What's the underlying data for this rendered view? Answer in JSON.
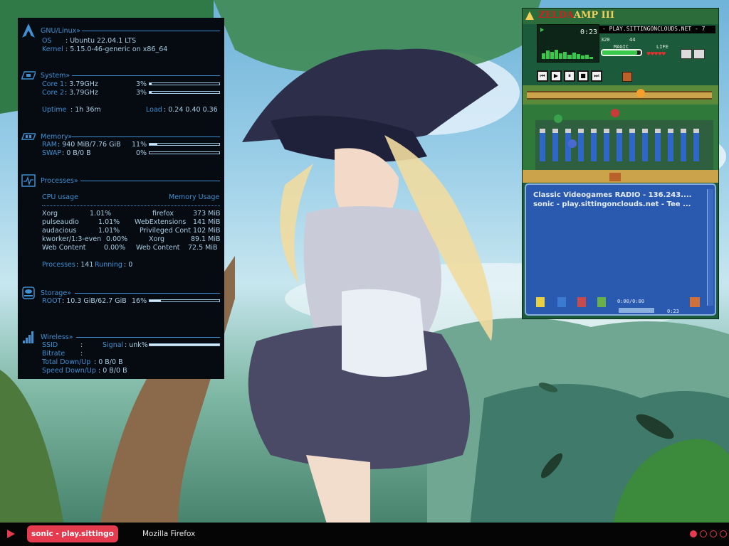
{
  "conky": {
    "gnu": {
      "title": "GNU/Linux»",
      "os_label": "OS",
      "os_value": ": Ubuntu 22.04.1 LTS",
      "kernel_label": "Kernel",
      "kernel_value": ": 5.15.0-46-generic on x86_64"
    },
    "system": {
      "title": "System»",
      "cores": [
        {
          "label": "Core 1",
          "value": ": 3.79GHz",
          "pct": "3%",
          "fill": 0.03
        },
        {
          "label": "Core 2",
          "value": ": 3.79GHz",
          "pct": "3%",
          "fill": 0.03
        }
      ],
      "uptime_label": "Uptime",
      "uptime_value": ": 1h 36m",
      "load_label": "Load",
      "load_value": ": 0.24 0.40 0.36"
    },
    "memory": {
      "title": "Memory»",
      "ram_label": "RAM",
      "ram_value": ": 940 MiB/7.76 GiB",
      "ram_pct": "11%",
      "ram_fill": 0.11,
      "swap_label": "SWAP",
      "swap_value": ": 0 B/0 B",
      "swap_pct": "0%",
      "swap_fill": 0
    },
    "processes": {
      "title": "Processes»",
      "cpu_header": "CPU usage",
      "mem_header": "Memory Usage",
      "cpu_rows": [
        {
          "name": "Xorg",
          "value": "1.01%"
        },
        {
          "name": "pulseaudio",
          "value": "1.01%"
        },
        {
          "name": "audacious",
          "value": "1.01%"
        },
        {
          "name": "kworker/1:3-even",
          "value": "0.00%"
        },
        {
          "name": "Web Content",
          "value": "0.00%"
        }
      ],
      "mem_rows": [
        {
          "name": "firefox",
          "value": "373 MiB"
        },
        {
          "name": "WebExtensions",
          "value": "141 MiB"
        },
        {
          "name": "Privileged Cont",
          "value": "102 MiB"
        },
        {
          "name": "Xorg",
          "value": "89.1 MiB"
        },
        {
          "name": "Web Content",
          "value": "72.5 MiB"
        }
      ],
      "count_label": "Processes",
      "count_value": ": 141",
      "running_label": "Running",
      "running_value": ": 0"
    },
    "storage": {
      "title": "Storage»",
      "root_label": "ROOT",
      "root_value": ": 10.3 GiB/62.7 GiB",
      "root_pct": "16%",
      "root_fill": 0.16
    },
    "wireless": {
      "title": "Wireless»",
      "ssid_label": "SSID",
      "ssid_value": ":",
      "signal_label": "Signal",
      "signal_value": ": unk%",
      "signal_fill": 1.0,
      "bitrate_label": "Bitrate",
      "bitrate_value": ":",
      "total_label": "Total Down/Up",
      "total_value": ": 0 B/0 B",
      "speed_label": "Speed Down/Up",
      "speed_value": ": 0 B/0 B"
    }
  },
  "amp": {
    "logo_main": "ZELDA",
    "logo_sub": "AMP III",
    "time": "0:23",
    "marquee": "- PLAY.SITTINGONCLOUDS.NET - 7",
    "bitrate": "320",
    "samplerate": "44",
    "magic_label": "MAGIC",
    "life_label": "LIFE",
    "magic_fill": 0.9,
    "hearts": "♥♥♥♥♥",
    "controls": [
      "⏮",
      "▶",
      "⏸",
      "■",
      "⏭"
    ],
    "playlist": [
      "Classic Videogames RADIO - 136.243....",
      "sonic - play.sittingonclouds.net - Tee ..."
    ],
    "pl_time": "0:00/0:00",
    "pl_counter": "0:23",
    "colors": {
      "bg": "#1b5a3a",
      "playlist": "#2a5ab0"
    }
  },
  "taskbar": {
    "active_task": "sonic - play.sittingo",
    "task2": "Mozilla Firefox",
    "workspaces": [
      true,
      false,
      false,
      false
    ],
    "accent": "#e43b4f"
  }
}
